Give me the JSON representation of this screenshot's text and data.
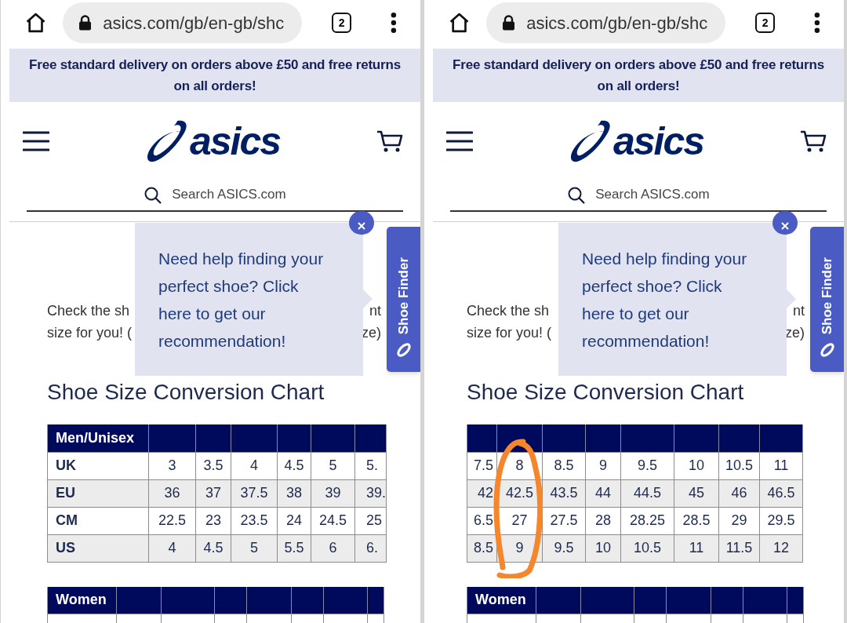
{
  "panels": [
    {
      "browser": {
        "url": "asics.com/gb/en-gb/shc",
        "tab_count": "2"
      },
      "banner": "Free standard delivery on orders above £50 and free returns on all orders!",
      "logo": "asics",
      "search": {
        "placeholder": "Search ASICS.com"
      },
      "intro": {
        "left": [
          "Check the sh",
          "size for you! ("
        ],
        "right": [
          "nt",
          "ze)"
        ]
      },
      "popup": {
        "text": "Need help finding your perfect shoe? Click here to get our recommendation!"
      },
      "shoe_finder": "Shoe Finder",
      "heading": "Shoe Size Conversion Chart",
      "tables": [
        {
          "columns": [
            {
              "kind": "label",
              "heading": "Men/Unisex"
            },
            {
              "kind": "value"
            },
            {
              "kind": "value"
            },
            {
              "kind": "value"
            },
            {
              "kind": "value"
            },
            {
              "kind": "value"
            },
            {
              "kind": "value"
            }
          ],
          "rows": [
            [
              "UK",
              "3",
              "3.5",
              "4",
              "4.5",
              "5",
              "5."
            ],
            [
              "EU",
              "36",
              "37",
              "37.5",
              "38",
              "39",
              "39."
            ],
            [
              "CM",
              "22.5",
              "23",
              "23.5",
              "24",
              "24.5",
              "25"
            ],
            [
              "US",
              "4",
              "4.5",
              "5",
              "5.5",
              "6",
              "6."
            ]
          ]
        },
        {
          "columns": [
            {
              "kind": "label",
              "heading": "Women"
            },
            {
              "kind": "value"
            },
            {
              "kind": "value"
            },
            {
              "kind": "value"
            },
            {
              "kind": "value"
            },
            {
              "kind": "value"
            },
            {
              "kind": "value"
            },
            {
              "kind": "value"
            }
          ]
        }
      ]
    },
    {
      "browser": {
        "url": "asics.com/gb/en-gb/shc",
        "tab_count": "2"
      },
      "banner": "Free standard delivery on orders above £50 and free returns on all orders!",
      "logo": "asics",
      "search": {
        "placeholder": "Search ASICS.com"
      },
      "intro": {
        "left": [
          "Check the sh",
          "size for you! ("
        ],
        "right": [
          "nt",
          "ze)"
        ]
      },
      "popup": {
        "text": "Need help finding your perfect shoe? Click here to get our recommendation!"
      },
      "shoe_finder": "Shoe Finder",
      "heading": "Shoe Size Conversion Chart",
      "tables": [
        {
          "columns": [
            {
              "kind": "value",
              "circled": false
            },
            {
              "kind": "value",
              "circled": true
            },
            {
              "kind": "value",
              "circled": false
            },
            {
              "kind": "value",
              "circled": false
            },
            {
              "kind": "value",
              "circled": false
            },
            {
              "kind": "value",
              "circled": false
            },
            {
              "kind": "value",
              "circled": false
            },
            {
              "kind": "value",
              "circled": false
            }
          ],
          "rows": [
            [
              "7.5",
              "8",
              "8.5",
              "9",
              "9.5",
              "10",
              "10.5",
              "11"
            ],
            [
              "42",
              "42.5",
              "43.5",
              "44",
              "44.5",
              "45",
              "46",
              "46.5"
            ],
            [
              "6.5",
              "27",
              "27.5",
              "28",
              "28.25",
              "28.5",
              "29",
              "29.5"
            ],
            [
              "8.5",
              "9",
              "9.5",
              "10",
              "10.5",
              "11",
              "11.5",
              "12"
            ]
          ]
        },
        {
          "columns": [
            {
              "kind": "label",
              "heading": "Women"
            },
            {
              "kind": "value"
            },
            {
              "kind": "value"
            },
            {
              "kind": "value"
            },
            {
              "kind": "value"
            },
            {
              "kind": "value"
            },
            {
              "kind": "value"
            },
            {
              "kind": "value"
            }
          ]
        }
      ]
    }
  ]
}
